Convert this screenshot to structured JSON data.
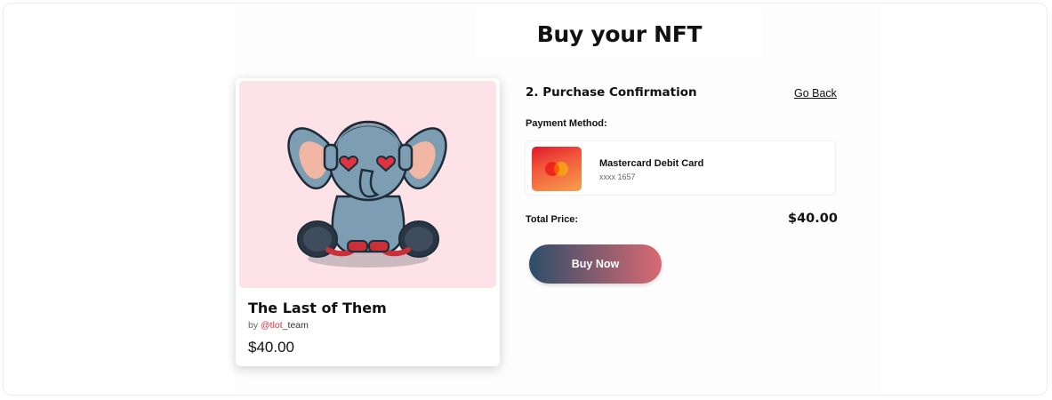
{
  "page": {
    "title": "Buy your NFT"
  },
  "nft": {
    "name": "The Last of Them",
    "by_prefix": "by ",
    "handle_at": "@tlot",
    "handle_rest": "_team",
    "price": "$40.00",
    "image": "elephant-illustration"
  },
  "purchase": {
    "step_title": "2. Purchase Confirmation",
    "go_back": "Go Back",
    "payment_label": "Payment Method:",
    "payment_method": {
      "name": "Mastercard Debit Card",
      "number": "xxxx 1657",
      "icon": "mastercard-logo"
    },
    "total_label": "Total Price:",
    "total_value": "$40.00",
    "buy_label": "Buy Now"
  },
  "colors": {
    "art_background": "#fde2e8",
    "handle_accent": "#d9333f",
    "button_gradient_start": "#2c4d68",
    "button_gradient_end": "#d96a72"
  }
}
